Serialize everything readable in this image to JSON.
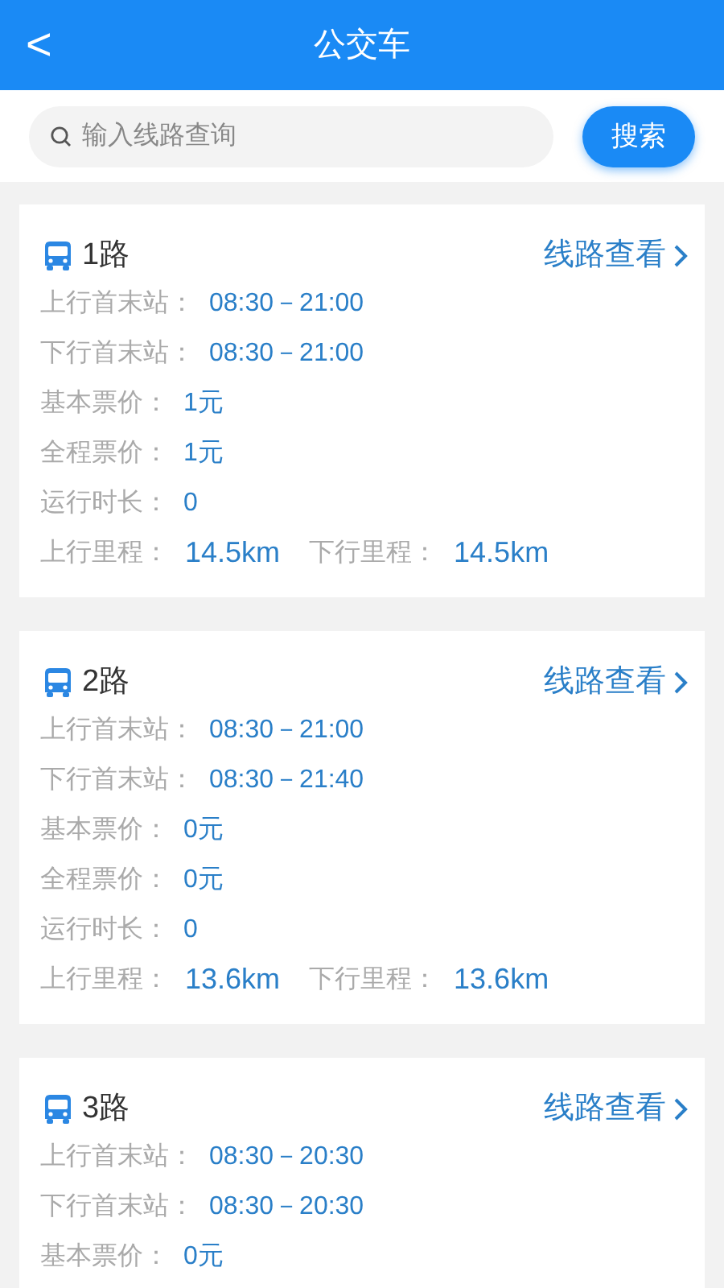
{
  "header": {
    "back": "<",
    "title": "公交车"
  },
  "search": {
    "placeholder": "输入线路查询",
    "button": "搜索"
  },
  "routes": [
    {
      "name": "1路",
      "link": "线路查看",
      "fields": [
        {
          "label": "上行首末站：",
          "value": "08:30－21:00"
        },
        {
          "label": "下行首末站：",
          "value": "08:30－21:00"
        },
        {
          "label": "基本票价：",
          "value": "1元"
        },
        {
          "label": "全程票价：",
          "value": "1元"
        },
        {
          "label": "运行时长：",
          "value": "0"
        }
      ],
      "mileage": [
        {
          "label": "上行里程：",
          "value": "14.5km"
        },
        {
          "label": "下行里程：",
          "value": "14.5km"
        }
      ]
    },
    {
      "name": "2路",
      "link": "线路查看",
      "fields": [
        {
          "label": "上行首末站：",
          "value": "08:30－21:00"
        },
        {
          "label": "下行首末站：",
          "value": "08:30－21:40"
        },
        {
          "label": "基本票价：",
          "value": "0元"
        },
        {
          "label": "全程票价：",
          "value": "0元"
        },
        {
          "label": "运行时长：",
          "value": "0"
        }
      ],
      "mileage": [
        {
          "label": "上行里程：",
          "value": "13.6km"
        },
        {
          "label": "下行里程：",
          "value": "13.6km"
        }
      ]
    },
    {
      "name": "3路",
      "link": "线路查看",
      "fields": [
        {
          "label": "上行首末站：",
          "value": "08:30－20:30"
        },
        {
          "label": "下行首末站：",
          "value": "08:30－20:30"
        },
        {
          "label": "基本票价：",
          "value": "0元"
        }
      ]
    }
  ]
}
